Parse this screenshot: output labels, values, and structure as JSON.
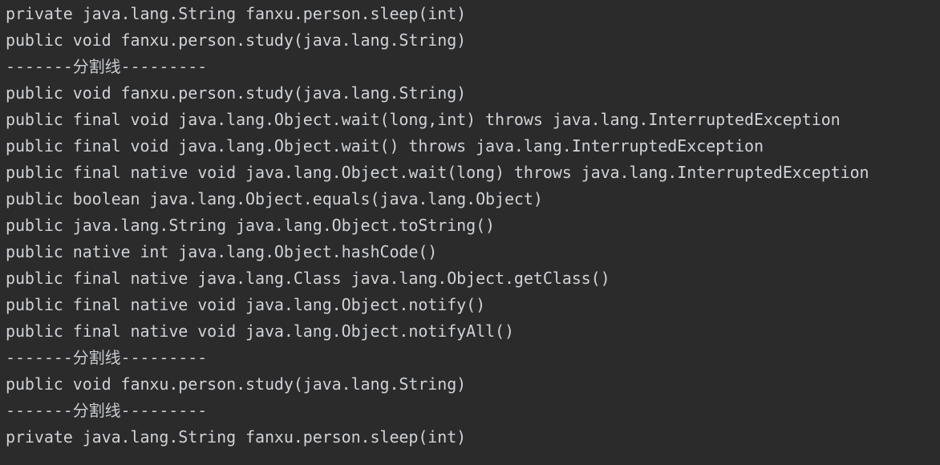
{
  "console": {
    "lines": [
      "private java.lang.String fanxu.person.sleep(int)",
      "public void fanxu.person.study(java.lang.String)",
      "-------分割线---------",
      "public void fanxu.person.study(java.lang.String)",
      "public final void java.lang.Object.wait(long,int) throws java.lang.InterruptedException",
      "public final void java.lang.Object.wait() throws java.lang.InterruptedException",
      "public final native void java.lang.Object.wait(long) throws java.lang.InterruptedException",
      "public boolean java.lang.Object.equals(java.lang.Object)",
      "public java.lang.String java.lang.Object.toString()",
      "public native int java.lang.Object.hashCode()",
      "public final native java.lang.Class java.lang.Object.getClass()",
      "public final native void java.lang.Object.notify()",
      "public final native void java.lang.Object.notifyAll()",
      "-------分割线---------",
      "public void fanxu.person.study(java.lang.String)",
      "-------分割线---------",
      "private java.lang.String fanxu.person.sleep(int)"
    ]
  },
  "colors": {
    "background": "#2b2b2b",
    "text": "#cfd2d6"
  }
}
